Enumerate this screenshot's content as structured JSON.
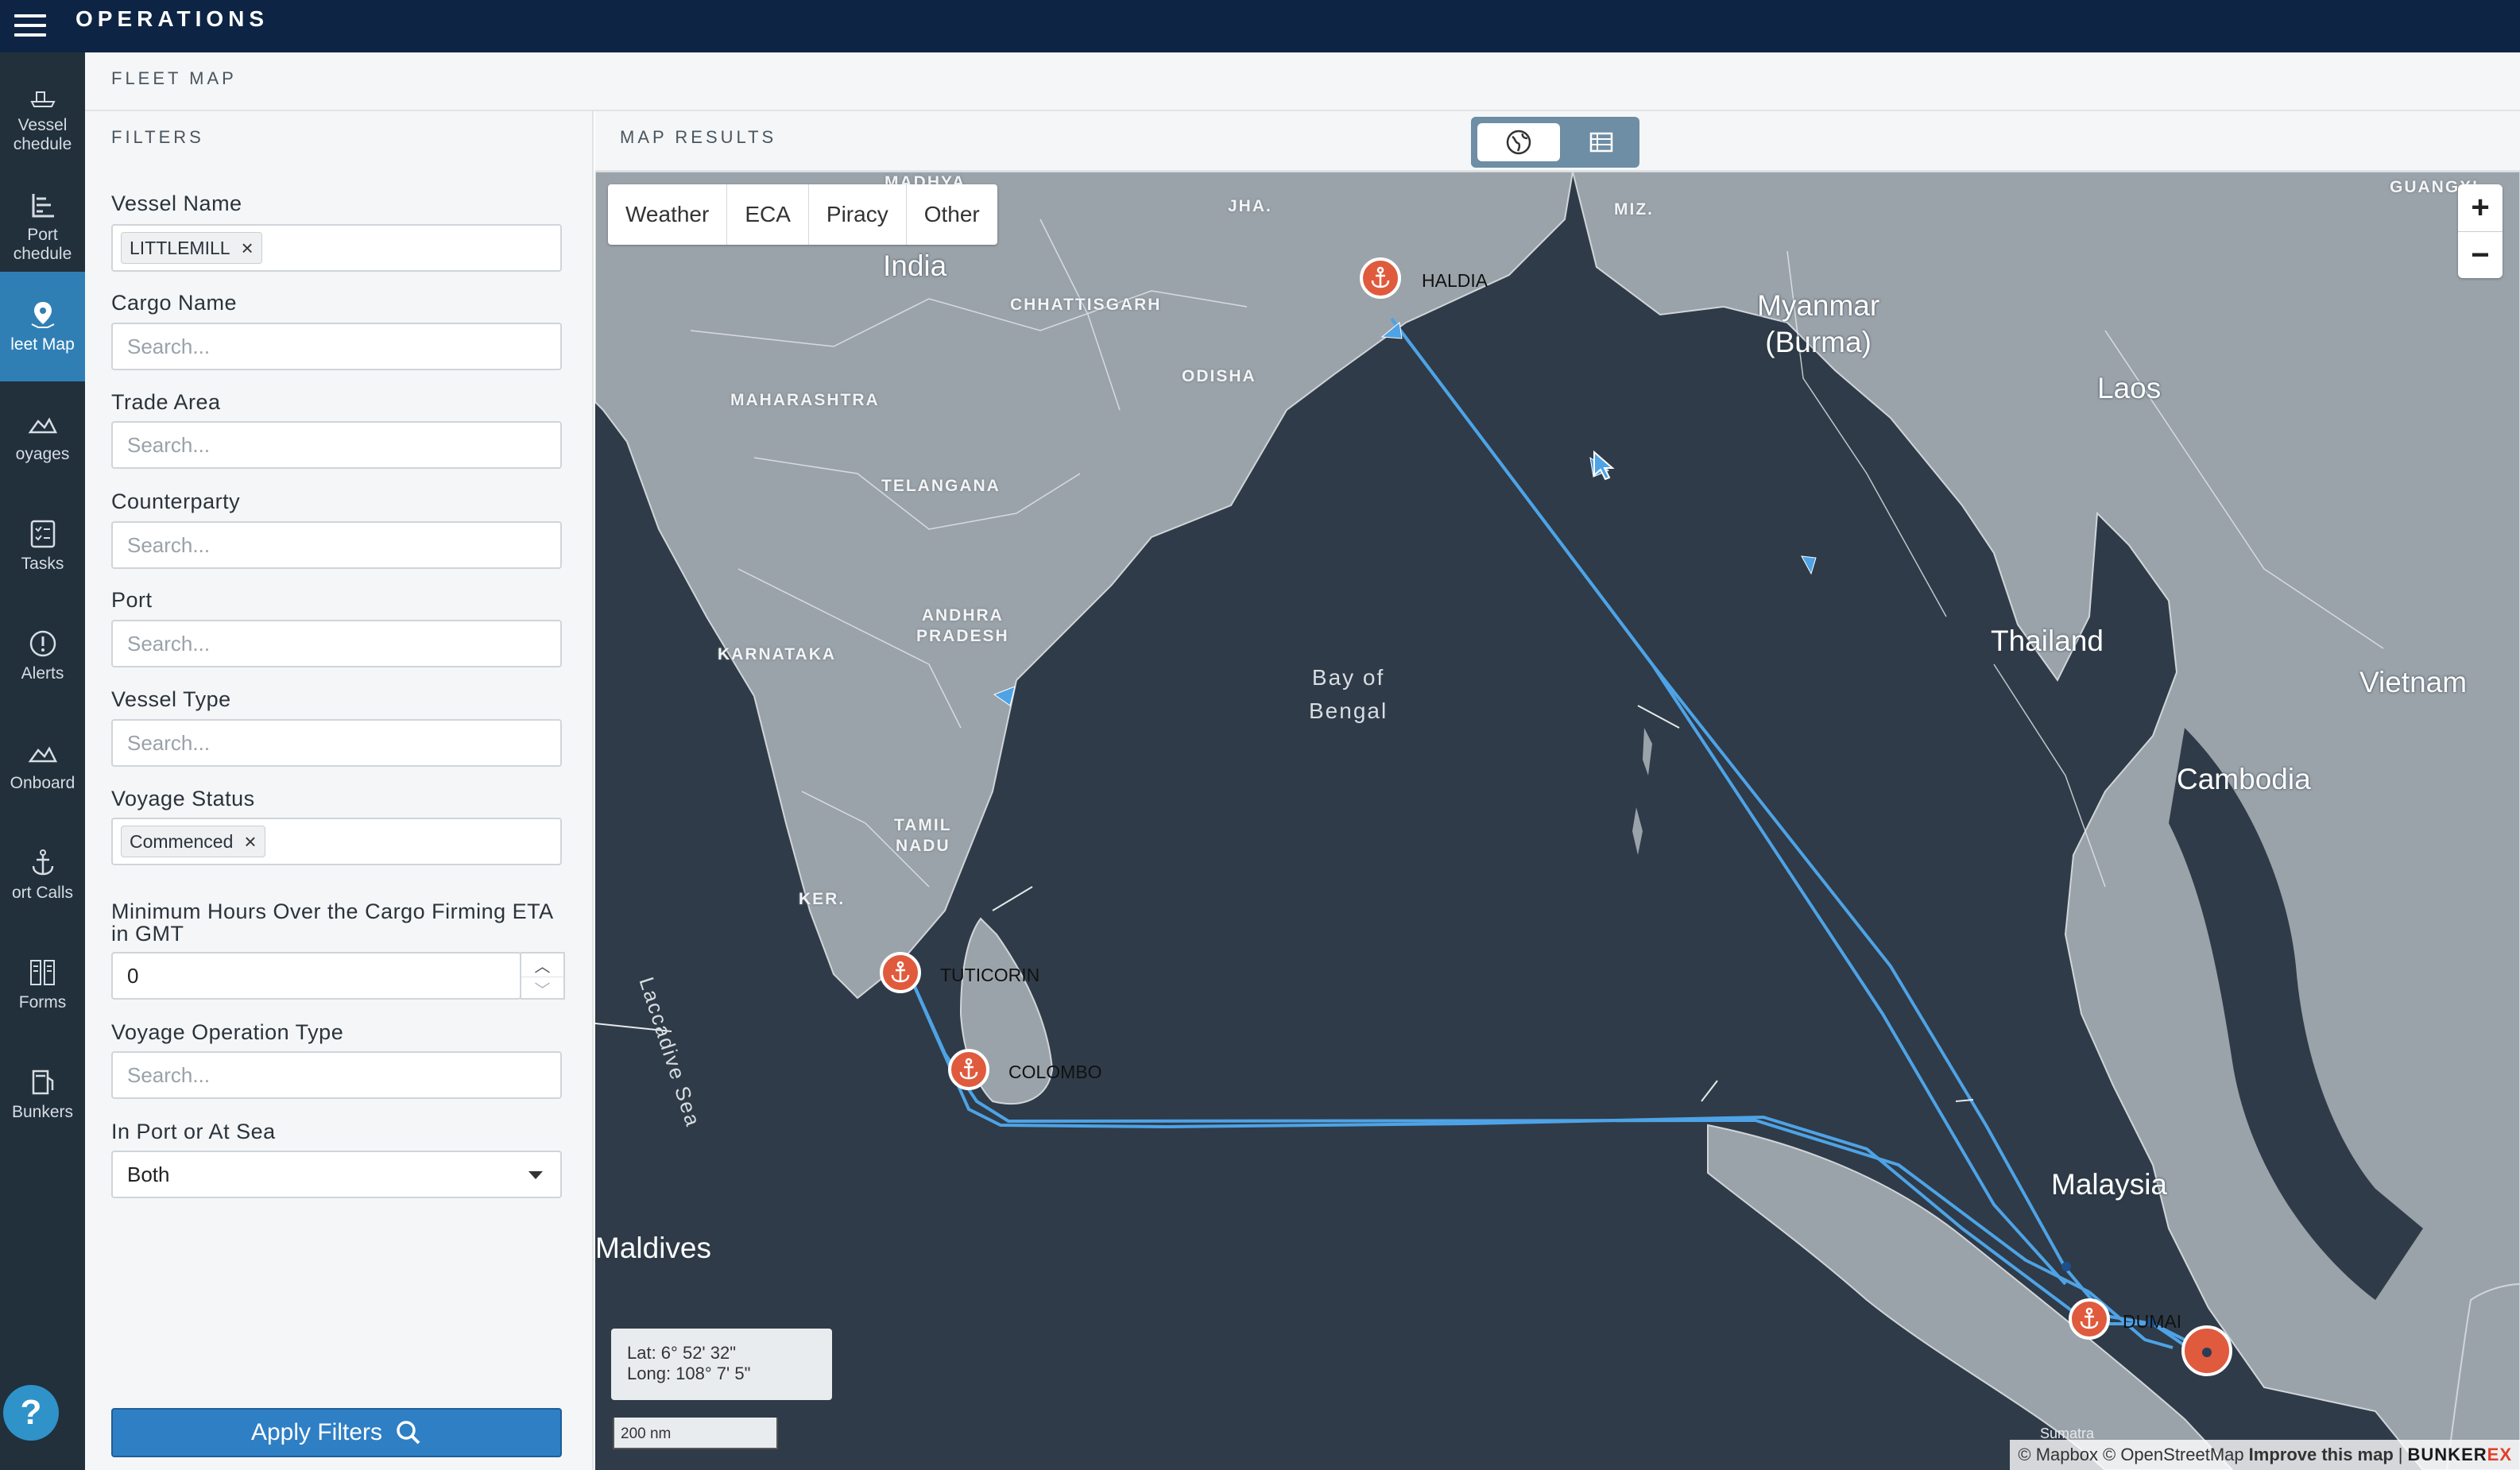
{
  "app": {
    "title": "OPERATIONS"
  },
  "nav": {
    "items": [
      {
        "label": "Vessel\nchedule",
        "icon": "ship-icon"
      },
      {
        "label": "Port\nchedule",
        "icon": "port-schedule-icon"
      },
      {
        "label": "leet Map",
        "icon": "map-pin-icon",
        "active": true
      },
      {
        "label": "oyages",
        "icon": "route-icon"
      },
      {
        "label": "Tasks",
        "icon": "checklist-icon"
      },
      {
        "label": "Alerts",
        "icon": "alert-icon"
      },
      {
        "label": "Onboard",
        "icon": "onboard-icon"
      },
      {
        "label": "ort Calls",
        "icon": "anchor-icon"
      },
      {
        "label": "Forms",
        "icon": "forms-icon"
      },
      {
        "label": "Bunkers",
        "icon": "fuel-icon"
      }
    ],
    "help": "?"
  },
  "page": {
    "title": "FLEET MAP"
  },
  "filters": {
    "header": "FILTERS",
    "vessel_name": {
      "label": "Vessel Name",
      "chip": "LITTLEMILL"
    },
    "cargo_name": {
      "label": "Cargo Name",
      "placeholder": "Search..."
    },
    "trade_area": {
      "label": "Trade Area",
      "placeholder": "Search..."
    },
    "counterparty": {
      "label": "Counterparty",
      "placeholder": "Search..."
    },
    "port": {
      "label": "Port",
      "placeholder": "Search..."
    },
    "vessel_type": {
      "label": "Vessel Type",
      "placeholder": "Search..."
    },
    "voyage_status": {
      "label": "Voyage Status",
      "chip": "Commenced"
    },
    "min_hours": {
      "label": "Minimum Hours Over the Cargo Firming ETA in GMT",
      "value": "0"
    },
    "voyage_operation_type": {
      "label": "Voyage Operation Type",
      "placeholder": "Search..."
    },
    "in_port_or_at_sea": {
      "label": "In Port or At Sea",
      "value": "Both"
    },
    "apply_label": "Apply Filters"
  },
  "map": {
    "header": "MAP RESULTS",
    "layers": [
      "Weather",
      "ECA",
      "Piracy",
      "Other"
    ],
    "zoom_in": "+",
    "zoom_out": "−",
    "coords": {
      "lat": "Lat: 6° 52' 32\"",
      "long": "Long: 108° 7' 5\""
    },
    "scale": "200 nm",
    "attribution": {
      "mapbox": "© Mapbox",
      "osm": "© OpenStreetMap",
      "improve": "Improve this map",
      "sep": "|",
      "brand_a": "BUNKER",
      "brand_b": "EX"
    },
    "countries": {
      "india": "India",
      "myanmar": "Myanmar\n(Burma)",
      "laos": "Laos",
      "thailand": "Thailand",
      "vietnam": "Vietnam",
      "cambodia": "Cambodia",
      "malaysia": "Malaysia",
      "maldives": "Maldives"
    },
    "states": {
      "madhya": "MADHYA",
      "jha": "JHA.",
      "miz": "MIZ.",
      "guangxi": "GUANGXI",
      "chhattisgarh": "CHHATTISGARH",
      "odisha": "ODISHA",
      "maharashtra": "MAHARASHTRA",
      "telangana": "TELANGANA",
      "andhra": "ANDHRA\nPRADESH",
      "karnataka": "KARNATAKA",
      "tamil": "TAMIL\nNADU",
      "ker": "KER."
    },
    "seas": {
      "bay": "Bay of\nBengal",
      "laccadive": "Laccadive Sea",
      "sumatra": "Sumatra"
    },
    "ports": {
      "haldia": "HALDIA",
      "tuticorin": "TUTICORIN",
      "colombo": "COLOMBO",
      "dumai": "DUMAI"
    },
    "colors": {
      "land": "#9ba3aa",
      "sea": "#2f3b48",
      "route": "#4ea3e6",
      "port": "#e05a3d",
      "nav_bg": "#22303c",
      "topbar": "#0d2444",
      "accent": "#2f7fc4"
    }
  }
}
